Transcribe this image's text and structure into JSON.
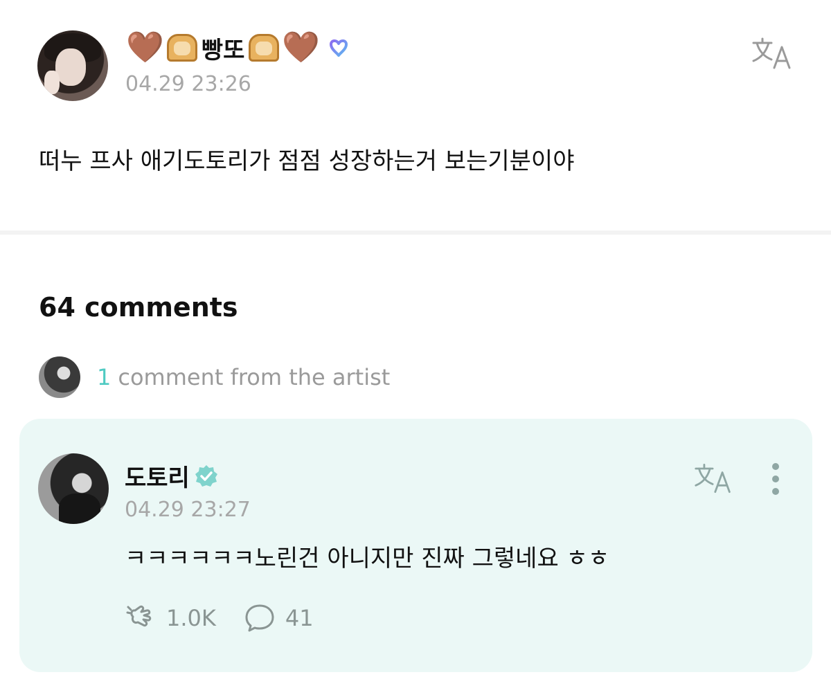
{
  "post": {
    "author": {
      "decorations": [
        "🤎",
        "🍞"
      ],
      "name": "빵또",
      "badge": "weverse-membership-icon"
    },
    "time": "04.29 23:26",
    "text": "떠누 프사 애기도토리가 점점 성장하는거 보는기분이야"
  },
  "comments": {
    "title": "64 comments",
    "artist_summary": {
      "count": "1",
      "label": "comment from the artist"
    }
  },
  "artist_comment": {
    "author": "도토리",
    "time": "04.29 23:27",
    "text": "ㅋㅋㅋㅋㅋㅋ노린건 아니지만 진짜 그렇네요 ㅎㅎ",
    "likes": "1.0K",
    "replies": "41"
  },
  "colors": {
    "accent_teal": "#4fcac2",
    "card_bg": "#ebf8f6",
    "muted_text": "#a7a7a7",
    "verified_badge": "#7fd3cc"
  },
  "icons": {
    "translate": "translate-icon",
    "more": "more-vertical-icon",
    "like": "cheer-icon",
    "reply": "chat-bubble-icon"
  }
}
